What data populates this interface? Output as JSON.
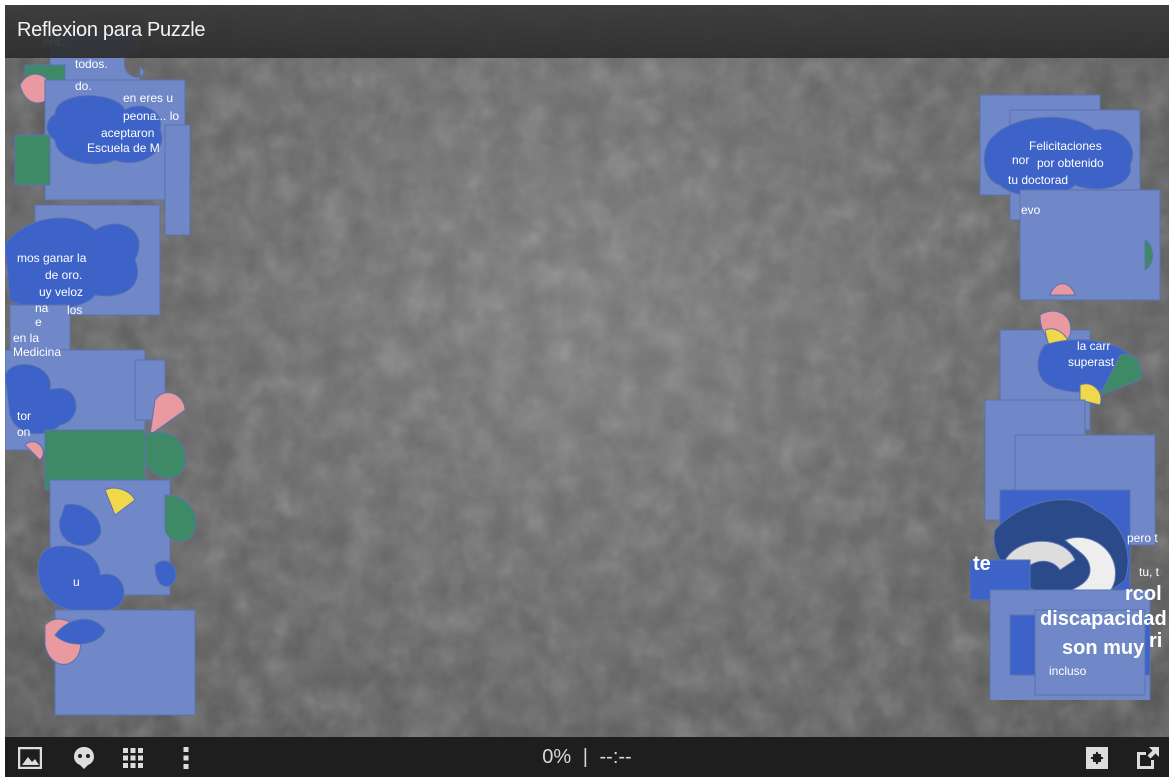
{
  "title": "Reflexion para Puzzle",
  "progress": {
    "percent_text": "0%",
    "separator": "|",
    "timer_text": "--:--"
  },
  "toolbar": {
    "left_icons": [
      "image-preview-icon",
      "ghost-image-icon",
      "grid-icon",
      "more-menu-icon"
    ],
    "right_icons": [
      "puzzle-piece-icon",
      "fullscreen-icon"
    ]
  },
  "pieces_text": {
    "left": [
      "era...",
      "todos.",
      "do.",
      "en eres u",
      "peona... lo",
      "aceptaron",
      "Escuela de M",
      "mos ganar la",
      "de oro.",
      "uy veloz",
      "na",
      "los",
      "e",
      "en la",
      "Medicina",
      "tor",
      "on",
      "u"
    ],
    "right": [
      "Felicitaciones",
      "por obtenido",
      "tu doctorad",
      "nor",
      "evo",
      "la carr",
      "superast",
      "pero t",
      "tu, t",
      "te",
      "rcol",
      "discapacidad",
      "son muy",
      "ri",
      "incluso"
    ]
  },
  "colors": {
    "piece_blue": "#7088c8",
    "piece_dark_blue": "#3d63c8",
    "piece_green": "#3f8a66",
    "piece_pink": "#e89aa0",
    "piece_yellow": "#f0d84a",
    "bar": "#1e1e1e"
  }
}
